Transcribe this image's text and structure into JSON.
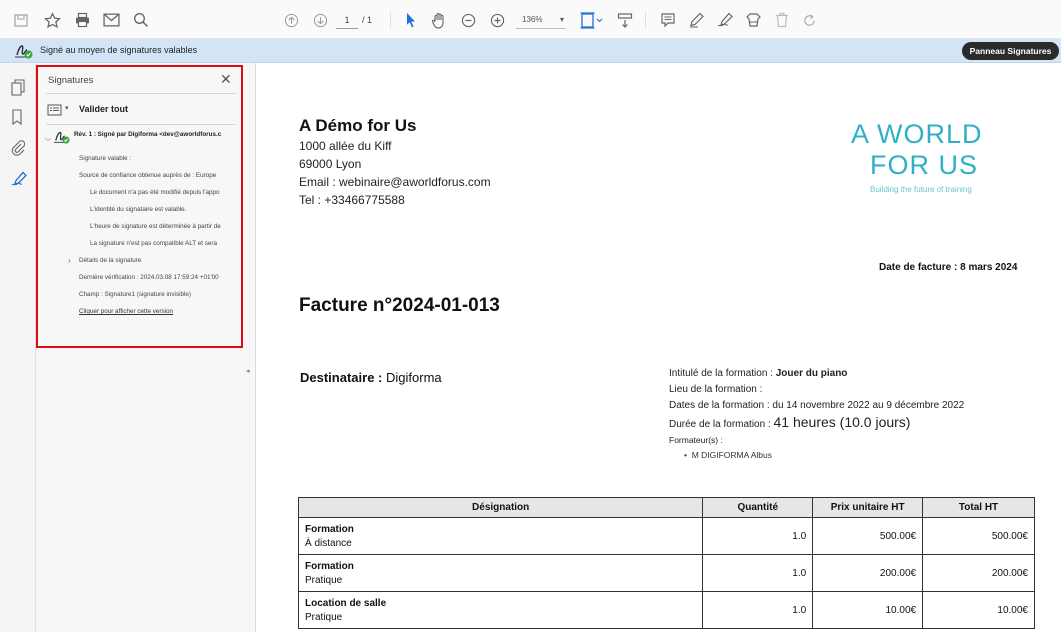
{
  "toolbar": {
    "page_current": "1",
    "page_total": "/ 1",
    "zoom": "136%"
  },
  "signature_bar": {
    "status_text": "Signé au moyen de signatures valables",
    "panel_button": "Panneau Signatures"
  },
  "signatures_panel": {
    "title": "Signatures",
    "validate_all": "Valider tout",
    "revision": "Rév. 1 : Signé par Digiforma <dev@aworldforus.c",
    "items": [
      "Signature valable :",
      "Source de confiance obtenue auprès de : Europe",
      "Le document n'a pas été modifié depuis l'appo",
      "L'identité du signataire est valable.",
      "L'heure de signature est déterminée à partir de",
      "La signature n'est pas compatible ALT et sera",
      "Détails de la signature",
      "Dernière vérification : 2024.03.08 17:59:24 +01'00",
      "Champ : Signature1 (signature invisible)",
      "Cliquer pour afficher cette version"
    ]
  },
  "document": {
    "company": "A Démo for Us",
    "address": [
      "1000 allée du Kiff",
      "69000 Lyon",
      "Email : webinaire@aworldforus.com",
      "Tel : +33466775588"
    ],
    "logo_line1": "A WORLD",
    "logo_line2": "FOR US",
    "logo_tagline": "Building the future of training",
    "invoice_date": "Date de facture : 8 mars 2024",
    "invoice_title": "Facture n°2024-01-013",
    "recipient_label": "Destinataire :",
    "recipient_name": "Digiforma",
    "training": {
      "title_label": "Intitulé de la formation :",
      "title_value": "Jouer du piano",
      "place_label": "Lieu de la formation :",
      "dates": "Dates de la formation : du 14 novembre 2022 au 9 décembre 2022",
      "duration_label": "Durée de la formation :",
      "duration_value": "41 heures (10.0 jours)",
      "trainers_label": "Formateur(s) :",
      "trainer": "M DIGIFORMA Albus"
    },
    "table": {
      "headers": [
        "Désignation",
        "Quantité",
        "Prix unitaire HT",
        "Total HT"
      ],
      "rows": [
        {
          "title": "Formation",
          "sub": "À distance",
          "qty": "1.0",
          "unit": "500.00€",
          "total": "500.00€"
        },
        {
          "title": "Formation",
          "sub": "Pratique",
          "qty": "1.0",
          "unit": "200.00€",
          "total": "200.00€"
        },
        {
          "title": "Location de salle",
          "sub": "Pratique",
          "qty": "1.0",
          "unit": "10.00€",
          "total": "10.00€"
        }
      ]
    }
  }
}
